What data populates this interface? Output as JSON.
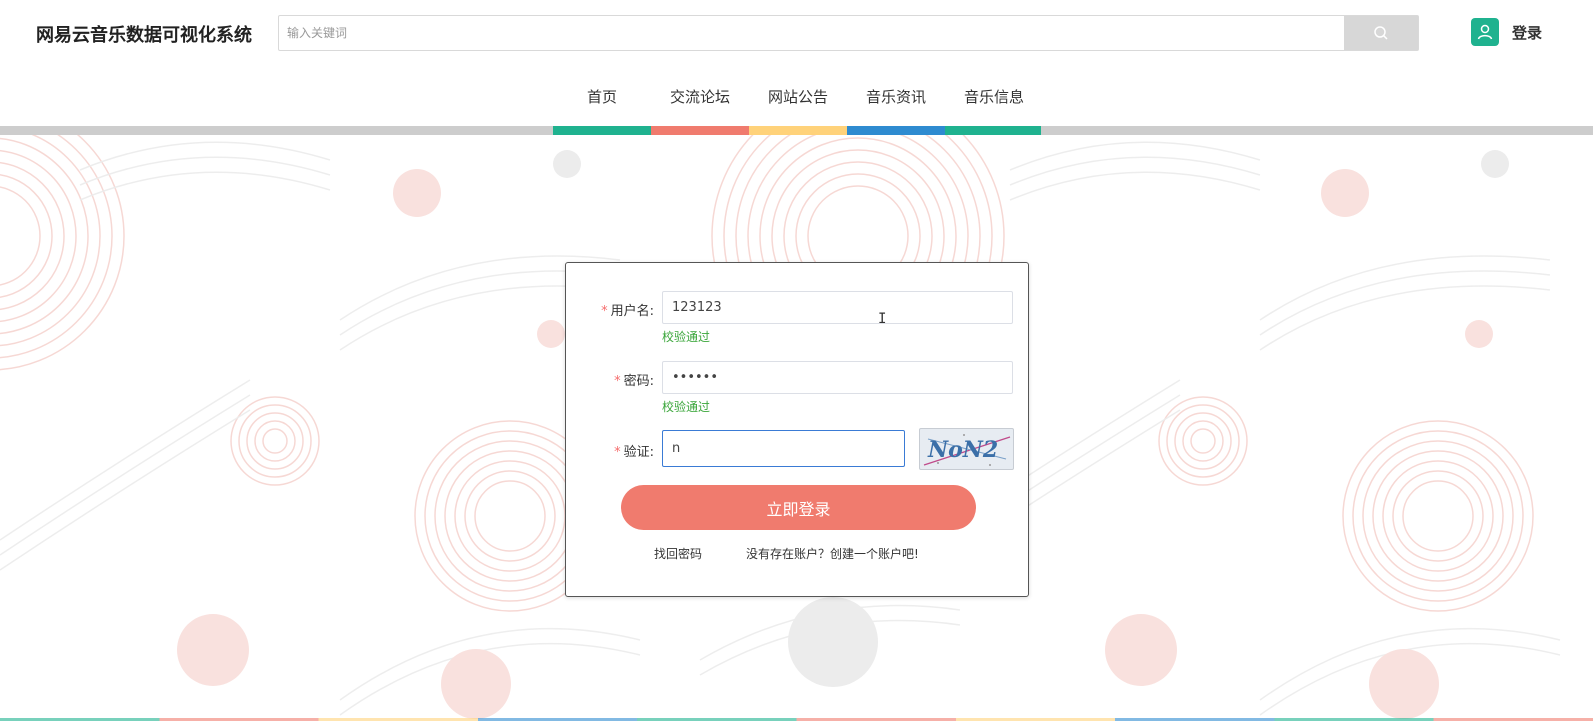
{
  "header": {
    "site_title": "网易云音乐数据可视化系统",
    "search_placeholder": "输入关键词",
    "search_icon": "search-icon",
    "avatar_icon": "user-icon",
    "login_label": "登录"
  },
  "nav": {
    "items": [
      {
        "label": "首页",
        "color": "#1fb28f"
      },
      {
        "label": "交流论坛",
        "color": "#f07b6e"
      },
      {
        "label": "网站公告",
        "color": "#ffd27a"
      },
      {
        "label": "音乐资讯",
        "color": "#2e8bd0"
      },
      {
        "label": "音乐信息",
        "color": "#1fb28f"
      }
    ]
  },
  "login_form": {
    "username": {
      "label": "用户名:",
      "value": "123123",
      "valid_msg": "校验通过"
    },
    "password": {
      "label": "密码:",
      "value": "••••••",
      "valid_msg": "校验通过"
    },
    "captcha": {
      "label": "验证:",
      "value": "n",
      "image_text": "NoN2"
    },
    "submit_label": "立即登录",
    "forgot_label": "找回密码",
    "register_label": "没有存在账户？创建一个账户吧!"
  },
  "colors": {
    "accent": "#f07b6e",
    "brand": "#1fb28f",
    "valid": "#3aa63a",
    "required": "#f56c6c"
  }
}
